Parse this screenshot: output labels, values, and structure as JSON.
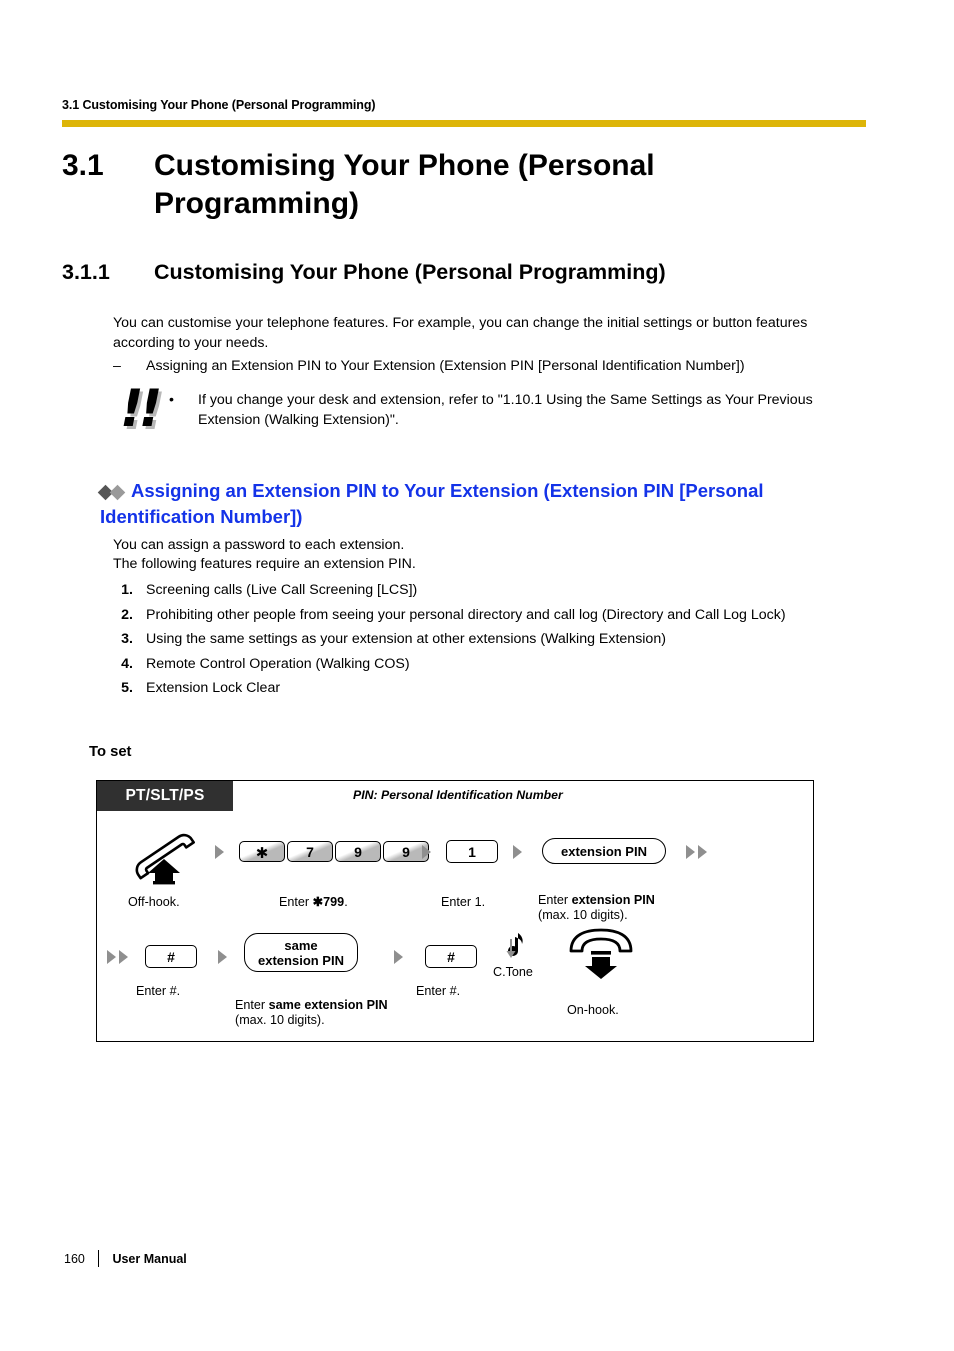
{
  "header": {
    "running_title": "3.1 Customising Your Phone (Personal Programming)",
    "rule_color": "#ddb508"
  },
  "chapter": {
    "number": "3.1",
    "title": "Customising Your Phone (Personal Programming)"
  },
  "section": {
    "number": "3.1.1",
    "title": "Customising Your Phone (Personal Programming)"
  },
  "body": {
    "intro": "You can customise your telephone features. For example, you can change the initial settings or button features according to your needs.",
    "dash_mark": "–",
    "dash_item": "Assigning an Extension PIN to Your Extension (Extension PIN [Personal Identification Number])"
  },
  "note": {
    "icon_glyph": "!!",
    "bullet": "•",
    "text": "If you change your desk and extension, refer to \"1.10.1 Using the Same Settings as Your Previous Extension (Walking Extension)\"."
  },
  "feature": {
    "heading": "Assigning an Extension PIN to Your Extension (Extension PIN [Personal Identification Number])",
    "heading_color": "#1433e8",
    "diamond1_color": "#555555",
    "diamond2_color": "#9a9a9a",
    "intro_line1": "You can assign a password to each extension.",
    "intro_line2": "The following features require an extension PIN.",
    "list": [
      {
        "num": "1.",
        "text": "Screening calls (Live Call Screening [LCS])"
      },
      {
        "num": "2.",
        "text": "Prohibiting other people from seeing your personal directory and call log (Directory and Call Log Lock)"
      },
      {
        "num": "3.",
        "text": "Using the same settings as your extension at other extensions (Walking Extension)"
      },
      {
        "num": "4.",
        "text": "Remote Control Operation (Walking COS)"
      },
      {
        "num": "5.",
        "text": "Extension Lock Clear"
      }
    ]
  },
  "procedure": {
    "label": "To set",
    "device_tag": "PT/SLT/PS",
    "pin_legend": "PIN: Personal Identification Number",
    "row1": {
      "offhook_caption": "Off-hook.",
      "keys": [
        "✱",
        "7",
        "9",
        "9"
      ],
      "keys_caption_prefix": "Enter ",
      "keys_caption_code": "✱799",
      "keys_caption_suffix": ".",
      "key_one": "1",
      "key_one_caption": "Enter 1.",
      "pin_pill": "extension PIN",
      "pin_caption_prefix": "Enter ",
      "pin_caption_bold": "extension PIN",
      "pin_caption_line2": "(max. 10 digits)."
    },
    "row2": {
      "hash_key": "#",
      "hash_caption": "Enter #.",
      "same_pin_line1": "same",
      "same_pin_line2": "extension PIN",
      "same_caption_prefix": "Enter ",
      "same_caption_bold": "same extension PIN",
      "same_caption_line2": "(max. 10 digits).",
      "hash_key2": "#",
      "hash_caption2": "Enter #.",
      "ctone_label": "C.Tone",
      "ctone_glyph": "♪",
      "onhook_caption": "On-hook."
    }
  },
  "footer": {
    "page_number": "160",
    "label": "User Manual"
  }
}
